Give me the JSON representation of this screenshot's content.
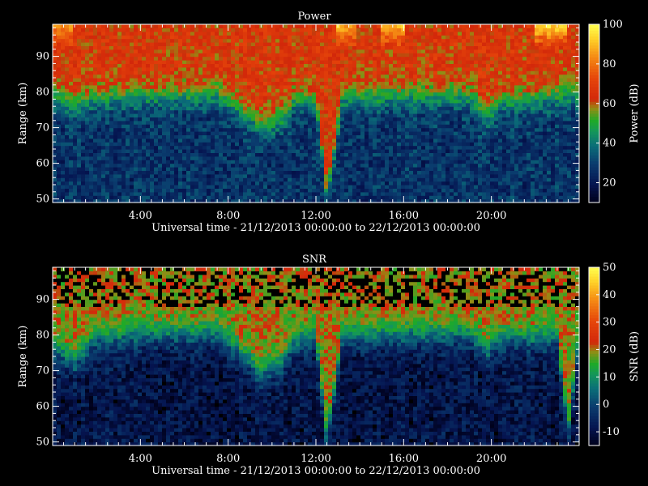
{
  "chart_data": [
    {
      "type": "heatmap",
      "title": "Power",
      "xlabel": "Universal time - 21/12/2013 00:00:00 to 22/12/2013 00:00:00",
      "ylabel": "Range (km)",
      "x_range_hours": [
        0,
        24
      ],
      "x_ticks": [
        "4:00",
        "8:00",
        "12:00",
        "16:00",
        "20:00"
      ],
      "x_tick_hours": [
        4,
        8,
        12,
        16,
        20
      ],
      "ylim": [
        49,
        99
      ],
      "y_ticks": [
        50,
        60,
        70,
        80,
        90
      ],
      "colorbar": {
        "label": "Power (dB)",
        "range": [
          10,
          100
        ],
        "ticks": [
          20,
          40,
          60,
          80,
          100
        ]
      },
      "colormap": "rainbow-dark",
      "upper_level_db": 65,
      "lower_level_db": 27,
      "transition_profile_km": [
        [
          0,
          79
        ],
        [
          1,
          76
        ],
        [
          2,
          78
        ],
        [
          4,
          78.5
        ],
        [
          6,
          78.5
        ],
        [
          7.5,
          79
        ],
        [
          8.5,
          75
        ],
        [
          9.5,
          70
        ],
        [
          10.5,
          72
        ],
        [
          11,
          77
        ],
        [
          12,
          78
        ],
        [
          12.5,
          50
        ],
        [
          13.2,
          78
        ],
        [
          16,
          78.5
        ],
        [
          19,
          78.5
        ],
        [
          19.8,
          73
        ],
        [
          20.5,
          77
        ],
        [
          24,
          79
        ]
      ],
      "top_enhancements": [
        {
          "hour_start": 0,
          "hour_end": 1,
          "value_db": 85
        },
        {
          "hour_start": 13,
          "hour_end": 13.8,
          "value_db": 90
        },
        {
          "hour_start": 15,
          "hour_end": 16,
          "value_db": 92
        },
        {
          "hour_start": 22,
          "hour_end": 23.5,
          "value_db": 95
        }
      ]
    },
    {
      "type": "heatmap",
      "title": "SNR",
      "xlabel": "Universal time - 21/12/2013 00:00:00 to 22/12/2013 00:00:00",
      "ylabel": "Range (km)",
      "x_range_hours": [
        0,
        24
      ],
      "x_ticks": [
        "4:00",
        "8:00",
        "12:00",
        "16:00",
        "20:00"
      ],
      "x_tick_hours": [
        4,
        8,
        12,
        16,
        20
      ],
      "ylim": [
        49,
        99
      ],
      "y_ticks": [
        50,
        60,
        70,
        80,
        90
      ],
      "colorbar": {
        "label": "SNR (dB)",
        "range": [
          -15,
          50
        ],
        "ticks": [
          -10,
          0,
          10,
          20,
          30,
          40,
          50
        ]
      },
      "colormap": "rainbow-dark",
      "upper_level_db": 20,
      "lower_level_db": -9,
      "transition_profile_km": [
        [
          0,
          76
        ],
        [
          1,
          72
        ],
        [
          2,
          79
        ],
        [
          4,
          80
        ],
        [
          6,
          80
        ],
        [
          7.5,
          80
        ],
        [
          8.5,
          75
        ],
        [
          9.5,
          69
        ],
        [
          10.5,
          72
        ],
        [
          11,
          78
        ],
        [
          12,
          79
        ],
        [
          12.5,
          50
        ],
        [
          13.2,
          79
        ],
        [
          16,
          80
        ],
        [
          19,
          80
        ],
        [
          19.8,
          75
        ],
        [
          20.5,
          79
        ],
        [
          23,
          79
        ],
        [
          23.5,
          52
        ],
        [
          24,
          79
        ]
      ],
      "top_dropouts_above_km": 88
    }
  ]
}
